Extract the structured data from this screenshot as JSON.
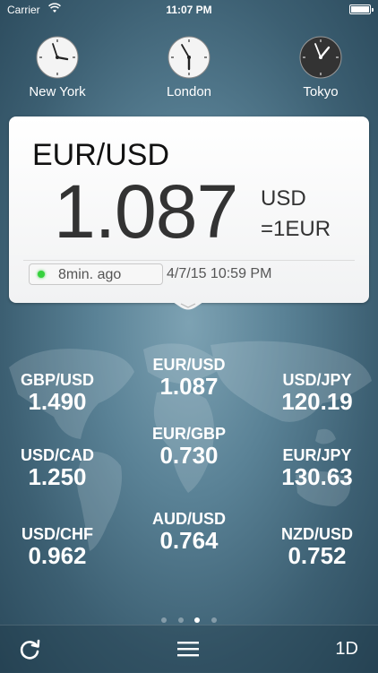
{
  "status_bar": {
    "carrier": "Carrier",
    "time": "11:07 PM"
  },
  "clocks": [
    {
      "city": "New York",
      "theme": "light"
    },
    {
      "city": "London",
      "theme": "light"
    },
    {
      "city": "Tokyo",
      "theme": "dark"
    }
  ],
  "main_card": {
    "pair": "EUR/USD",
    "rate": "1.087",
    "unit_line1": "USD",
    "unit_line2": "=1EUR",
    "updated_ago": "8min. ago",
    "timestamp": "4/7/15 10:59 PM",
    "status_color": "#36d13d"
  },
  "pairs": [
    {
      "name": "GBP/USD",
      "value": "1.490"
    },
    {
      "name": "EUR/USD",
      "value": "1.087"
    },
    {
      "name": "USD/JPY",
      "value": "120.19"
    },
    {
      "name": "USD/CAD",
      "value": "1.250"
    },
    {
      "name": "EUR/GBP",
      "value": "0.730"
    },
    {
      "name": "EUR/JPY",
      "value": "130.63"
    },
    {
      "name": "USD/CHF",
      "value": "0.962"
    },
    {
      "name": "AUD/USD",
      "value": "0.764"
    },
    {
      "name": "NZD/USD",
      "value": "0.752"
    }
  ],
  "pagination": {
    "pages": 4,
    "current": 3
  },
  "toolbar": {
    "refresh_icon": "refresh-icon",
    "menu_icon": "menu-icon",
    "range_label": "1D"
  }
}
